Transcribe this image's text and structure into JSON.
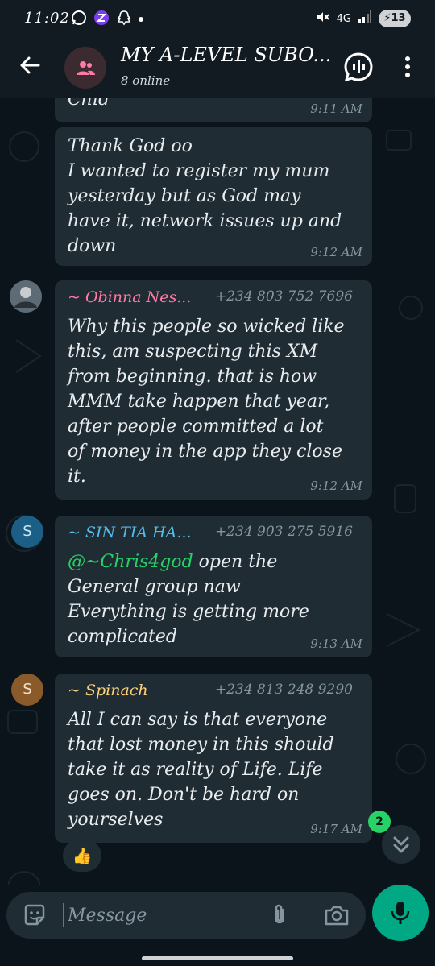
{
  "status_bar": {
    "time": "11:02",
    "network": "4G",
    "battery": "13",
    "icons": [
      "whatsapp-icon",
      "app-icon",
      "snapchat-icon",
      "mute-icon",
      "signal-icon"
    ]
  },
  "header": {
    "title": "MY A-LEVEL SUBO...",
    "subtitle": "8 online",
    "icons": [
      "back-arrow-icon",
      "group-icon",
      "voice-chat-icon",
      "more-vert-icon"
    ]
  },
  "messages": [
    {
      "partial_text": "Chid",
      "time": "9:11 AM"
    },
    {
      "text_lines": [
        "Thank God oo",
        "I wanted to register my mum",
        "yesterday but as God may",
        "have it, network issues up and",
        "down"
      ],
      "time": "9:12 AM"
    },
    {
      "sender": "~ Obinna Nes...",
      "sender_color": "#ff7ba6",
      "phone": "+234 803 752 7696",
      "text_lines": [
        "Why this people so wicked like",
        "this, am suspecting this XM",
        "from beginning. that is how",
        "MMM take happen that year,",
        "after people committed a lot",
        "of money in the app they close",
        "it."
      ],
      "time": "9:12 AM"
    },
    {
      "sender": "~ SIN TIA HA...",
      "sender_color": "#53bdeb",
      "phone": "+234 903 275 5916",
      "avatar_letter": "S",
      "avatar_color": "#1b5f86",
      "mention": "@~Chris4god",
      "text_after_mention": " open the",
      "text_lines": [
        "General group naw",
        "Everything is getting more",
        "complicated"
      ],
      "time": "9:13 AM"
    },
    {
      "sender": "~ Spinach",
      "sender_color": "#ffd279",
      "phone": "+234 813 248 9290",
      "avatar_letter": "S",
      "avatar_color": "#8a5a2b",
      "text_lines": [
        "All I can say is that everyone",
        "that lost money in this should",
        "take it as reality of Life. Life",
        "goes on. Don't be hard on",
        "yourselves"
      ],
      "time": "9:17 AM"
    }
  ],
  "reaction": "👍",
  "unread_count": "2",
  "composer": {
    "placeholder": "Message"
  },
  "colors": {
    "background": "#0b141a",
    "bubble": "#202c33",
    "accent": "#00a884"
  }
}
